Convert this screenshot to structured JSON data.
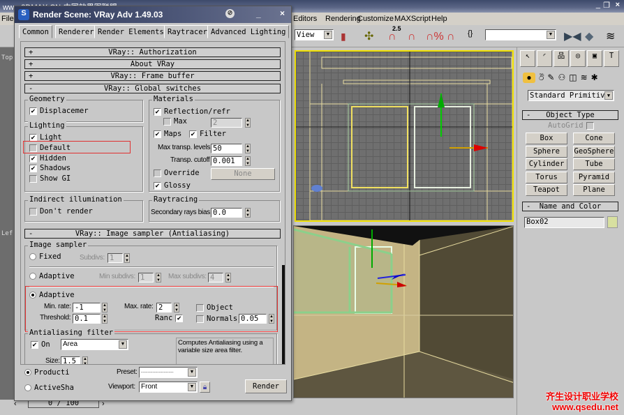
{
  "app": {
    "title": "www.3DMAX.CN-中国效果图联盟",
    "menu": [
      "Editors",
      "Rendering",
      "Customize",
      "MAXScript",
      "Help"
    ],
    "view_select": "View",
    "snap_value": "2.5",
    "viewport_labels": {
      "top": "Top",
      "left": "Lef"
    },
    "timeline": "0 / 100"
  },
  "command_panel": {
    "category": "Standard Primitiv",
    "object_type": {
      "title": "Object Type",
      "autogrid": "AutoGrid",
      "autogrid_checked": false,
      "buttons": [
        "Box",
        "Cone",
        "Sphere",
        "GeoSphere",
        "Cylinder",
        "Tube",
        "Torus",
        "Pyramid",
        "Teapot",
        "Plane"
      ]
    },
    "name_color": {
      "title": "Name and Color",
      "name": "Box02",
      "color": "#d8e0a0"
    }
  },
  "dialog": {
    "title": "Render Scene: VRay Adv 1.49.03",
    "tabs": [
      "Common",
      "Renderer",
      "Render Elements",
      "Raytracer",
      "Advanced Lighting"
    ],
    "active_tab": "Renderer",
    "rollouts": [
      {
        "sign": "+",
        "label": "VRay:: Authorization"
      },
      {
        "sign": "+",
        "label": "About VRay"
      },
      {
        "sign": "+",
        "label": "VRay:: Frame buffer"
      },
      {
        "sign": "-",
        "label": "VRay:: Global switches"
      },
      {
        "sign": "-",
        "label": "VRay:: Image sampler (Antialiasing)"
      }
    ],
    "global": {
      "geometry": {
        "title": "Geometry",
        "displacement": "Displacemer",
        "displacement_checked": true
      },
      "lighting": {
        "title": "Lighting",
        "items": [
          {
            "label": "Light",
            "checked": true
          },
          {
            "label": "Default",
            "checked": false
          },
          {
            "label": "Hidden",
            "checked": true
          },
          {
            "label": "Shadows",
            "checked": true
          },
          {
            "label": "Show GI",
            "checked": false
          }
        ]
      },
      "materials": {
        "title": "Materials",
        "reflection": "Reflection/refr",
        "max": "Max",
        "max_value": "2",
        "maps": "Maps",
        "filter": "Filter",
        "max_transp_label": "Max transp. levels",
        "max_transp": "50",
        "transp_cutoff_label": "Transp. cutoff",
        "transp_cutoff": "0.001",
        "override": "Override",
        "override_map": "None",
        "glossy": "Glossy"
      },
      "indirect": {
        "title": "Indirect illumination",
        "dont_render": "Don't render"
      },
      "raytracing": {
        "title": "Raytracing",
        "bias_label": "Secondary rays bias",
        "bias": "0.0"
      }
    },
    "sampler": {
      "title": "Image sampler",
      "fixed": "Fixed",
      "subdivs_label": "Subdivs:",
      "subdivs": "1",
      "adaptive_dmc": "Adaptive",
      "min_subdivs_label": "Min subdivs:",
      "min_subdivs": "1",
      "max_subdivs_label": "Max subdivs:",
      "max_subdivs": "4",
      "adaptive_sub": "Adaptive",
      "min_rate_label": "Min. rate:",
      "min_rate": "-1",
      "max_rate_label": "Max. rate:",
      "max_rate": "2",
      "threshold_label": "Threshold:",
      "threshold": "0.1",
      "rand": "Ranc",
      "object": "Object",
      "normals": "Normals",
      "normals_value": "0.05"
    },
    "aa_filter": {
      "title": "Antialiasing filter",
      "on": "On",
      "filter": "Area",
      "size_label": "Size:",
      "size": "1.5",
      "description": "Computes Antialiasing using a variable size area filter."
    },
    "bottom": {
      "production": "Producti",
      "activeshade": "ActiveSha",
      "preset_label": "Preset:",
      "preset": "--------------------",
      "viewport_label": "Viewport:",
      "viewport": "Front",
      "render": "Render"
    }
  },
  "watermark": {
    "line1": "齐生设计职业学校",
    "line2": "www.qsedu.net"
  }
}
